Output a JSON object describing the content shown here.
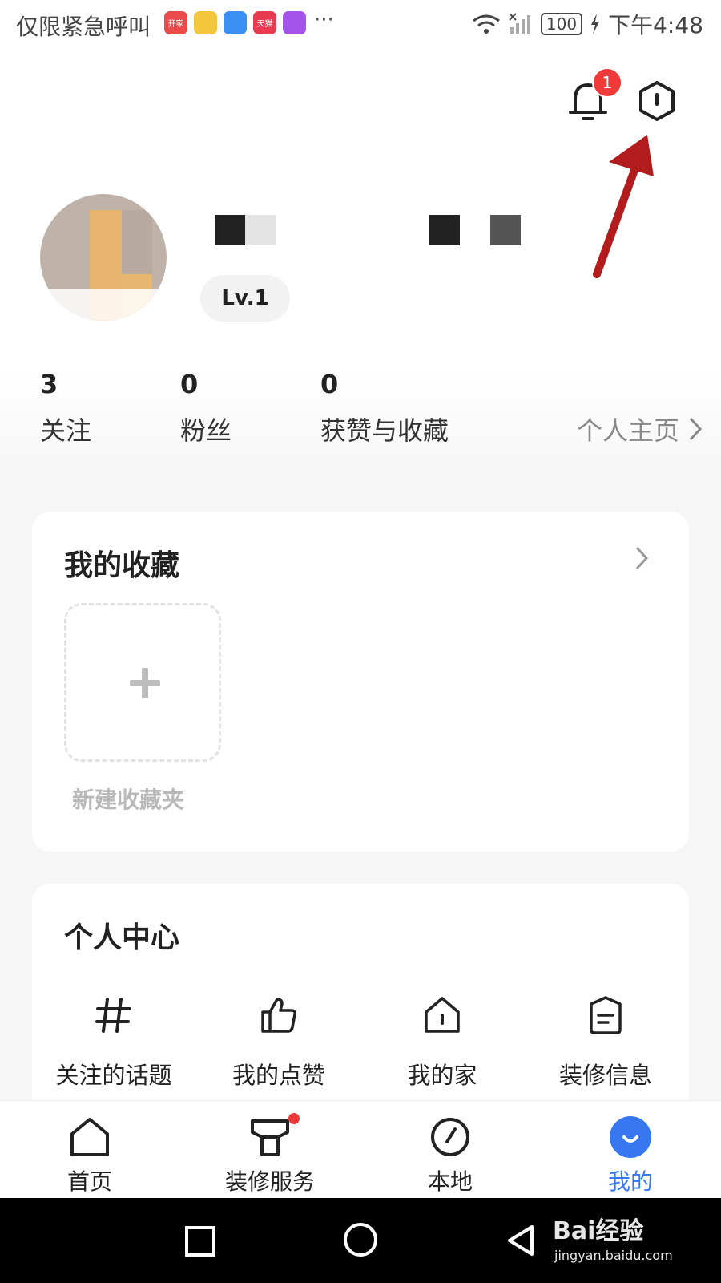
{
  "status_bar": {
    "carrier_text": "仅限紧急呼叫",
    "app_badges": [
      {
        "text": "开家",
        "color": "#e94a4a"
      },
      {
        "text": "",
        "color": "#f4c63d"
      },
      {
        "text": "",
        "color": "#3b8ef2"
      },
      {
        "text": "天猫",
        "color": "#e83b52"
      },
      {
        "text": "",
        "color": "#a454e8"
      }
    ],
    "more": "···",
    "battery": "100",
    "time": "下午4:48"
  },
  "header": {
    "notification_count": "1"
  },
  "profile": {
    "level": "Lv.1",
    "stats": [
      {
        "value": "3",
        "label": "关注"
      },
      {
        "value": "0",
        "label": "粉丝"
      },
      {
        "value": "0",
        "label": "获赞与收藏"
      }
    ],
    "homepage_link": "个人主页"
  },
  "favorites": {
    "title": "我的收藏",
    "new_folder_label": "新建收藏夹"
  },
  "personal_center": {
    "title": "个人中心",
    "items": [
      {
        "label": "关注的话题",
        "icon": "hashtag-icon"
      },
      {
        "label": "我的点赞",
        "icon": "thumbs-up-icon"
      },
      {
        "label": "我的家",
        "icon": "house-icon"
      },
      {
        "label": "装修信息",
        "icon": "document-icon"
      }
    ]
  },
  "tab_bar": {
    "tabs": [
      {
        "label": "首页",
        "icon": "home-icon"
      },
      {
        "label": "装修服务",
        "icon": "service-icon"
      },
      {
        "label": "本地",
        "icon": "compass-icon"
      },
      {
        "label": "我的",
        "icon": "profile-icon",
        "active": true
      }
    ],
    "active_color": "#3777f2"
  },
  "watermark": {
    "brand": "Bai经验",
    "url": "jingyan.baidu.com"
  }
}
